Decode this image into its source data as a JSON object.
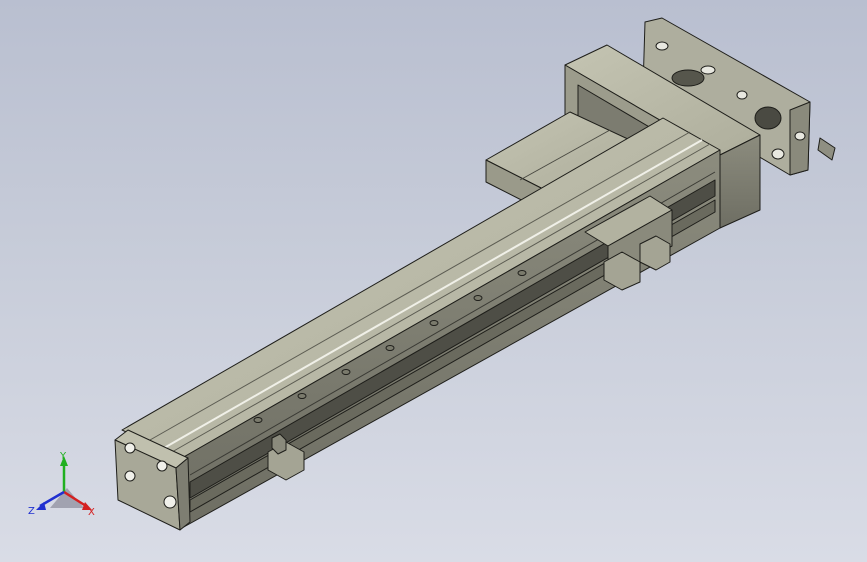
{
  "viewport": {
    "background_top": "#b9bfd0",
    "background_bottom": "#d9dce6"
  },
  "model": {
    "body_color": "#a7a794",
    "top_color": "#bdbdaa",
    "side_color": "#86867a",
    "edge_color": "#1e1e1a"
  },
  "triad": {
    "x_label": "X",
    "y_label": "Y",
    "z_label": "Z",
    "x_color": "#d42020",
    "y_color": "#20b020",
    "z_color": "#2030d0"
  }
}
